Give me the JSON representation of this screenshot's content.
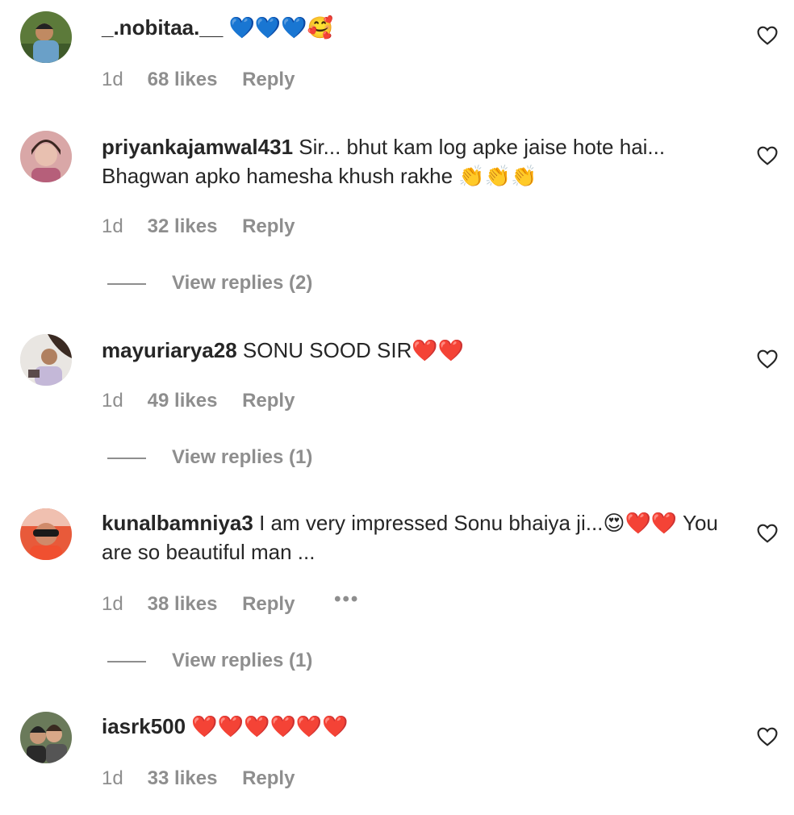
{
  "comments": [
    {
      "username": "_.nobitaa.__",
      "text": "💙💙💙🥰",
      "time": "1d",
      "likes": "68 likes",
      "reply": "Reply"
    },
    {
      "username": "priyankajamwal431",
      "text": "Sir... bhut kam log apke jaise hote hai... Bhagwan apko hamesha khush rakhe 👏👏👏",
      "time": "1d",
      "likes": "32 likes",
      "reply": "Reply",
      "view_replies": "View replies (2)"
    },
    {
      "username": "mayuriarya28",
      "text": "SONU SOOD SIR❤️❤️",
      "time": "1d",
      "likes": "49 likes",
      "reply": "Reply",
      "view_replies": "View replies (1)"
    },
    {
      "username": "kunalbamniya3",
      "text": "I am very impressed Sonu bhaiya ji...😍❤️❤️ You are so beautiful man ...",
      "time": "1d",
      "likes": "38 likes",
      "reply": "Reply",
      "more": "•••",
      "view_replies": "View replies (1)"
    },
    {
      "username": "iasrk500",
      "text": "❤️❤️❤️❤️❤️❤️",
      "time": "1d",
      "likes": "33 likes",
      "reply": "Reply"
    }
  ],
  "icons": {
    "like": "heart-outline-icon",
    "more": "more-options-icon"
  },
  "colors": {
    "text": "#262626",
    "secondary": "#8e8e8e",
    "background": "#ffffff"
  }
}
